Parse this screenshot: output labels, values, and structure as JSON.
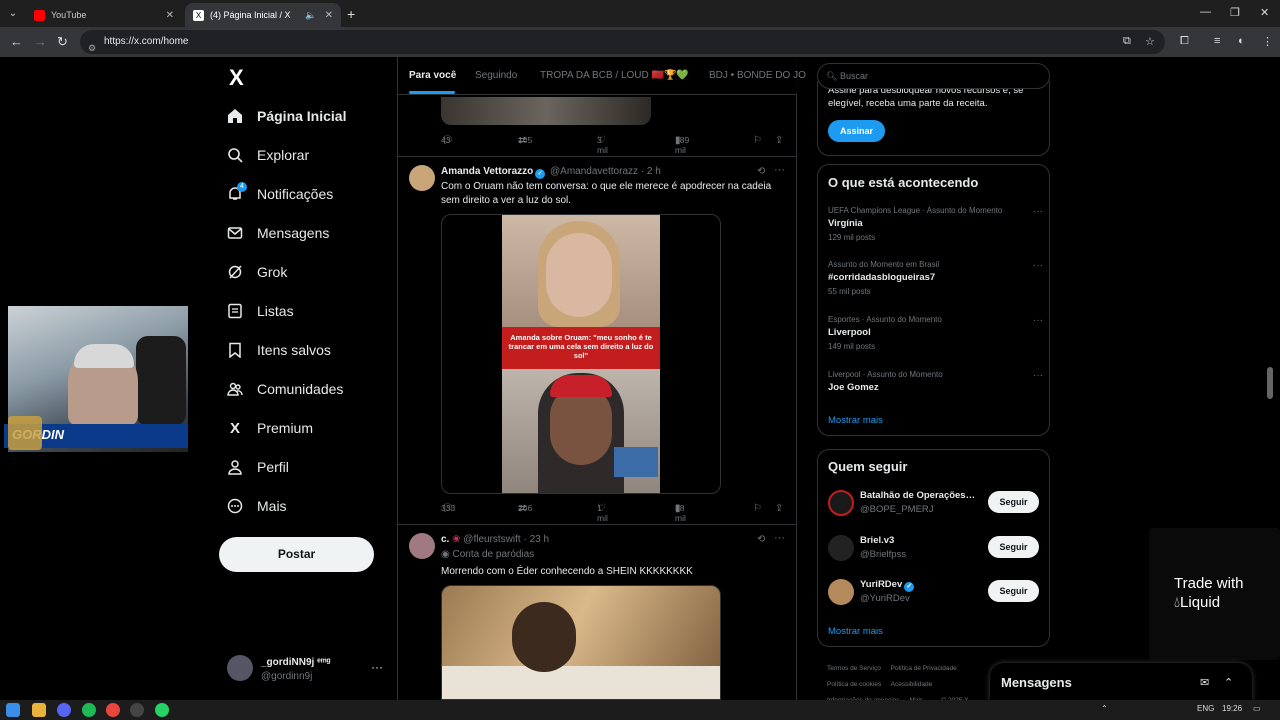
{
  "browser": {
    "tabs": [
      {
        "title": "YouTube",
        "active": false,
        "favicon_color": "#ff0000"
      },
      {
        "title": "(4) Página Inicial / X",
        "active": true,
        "favicon_color": "#ffffff"
      }
    ],
    "url": "https://x.com/home"
  },
  "nav": {
    "logo": "X",
    "items": [
      {
        "label": "Página Inicial",
        "icon": "home-icon"
      },
      {
        "label": "Explorar",
        "icon": "search-icon"
      },
      {
        "label": "Notificações",
        "icon": "bell-icon",
        "badge": "4"
      },
      {
        "label": "Mensagens",
        "icon": "envelope-icon"
      },
      {
        "label": "Grok",
        "icon": "grok-icon"
      },
      {
        "label": "Listas",
        "icon": "list-icon"
      },
      {
        "label": "Itens salvos",
        "icon": "bookmark-icon"
      },
      {
        "label": "Comunidades",
        "icon": "people-icon"
      },
      {
        "label": "Premium",
        "icon": "x-icon"
      },
      {
        "label": "Perfil",
        "icon": "person-icon"
      },
      {
        "label": "Mais",
        "icon": "more-circle-icon"
      }
    ],
    "post_button": "Postar",
    "account": {
      "name": "_gordiNN9j ᵉᵐᵍ",
      "handle": "@gordinn9j"
    }
  },
  "webcam": {
    "overlay_text": "GORDIN"
  },
  "feed": {
    "tabs": [
      "Para você",
      "Seguindo",
      "TROPA DA BCB / LOUD 🇲🇦🏆💚",
      "BDJ • BONDE DO JO"
    ],
    "prev_tweet_actions": {
      "replies": "43",
      "reposts": "105",
      "likes": "3 mil",
      "views": "189 mil"
    },
    "tweets": [
      {
        "name": "Amanda Vettorazzo",
        "handle": "@Amandavettorazz",
        "time": "· 2 h",
        "text": "Com o Oruam não tem conversa: o que ele merece é apodrecer na cadeia sem direito a ver a luz do sol.",
        "media_caption": "Amanda sobre Oruam: \"meu sonho é te trancar em uma cela sem direito a luz do sol\"",
        "actions": {
          "replies": "333",
          "reposts": "206",
          "likes": "1 mil",
          "views": "88 mil"
        }
      },
      {
        "name": "c.",
        "handle": "@fleurstswift",
        "time": "· 23 h",
        "label": "Conta de paródias",
        "text": "Morrendo com o Éder conhecendo a SHEIN KKKKKKKK"
      }
    ]
  },
  "sidebar": {
    "search_placeholder": "Buscar",
    "premium_text": "Assine para desbloquear novos recursos e, se elegível, receba uma parte da receita.",
    "subscribe": "Assinar",
    "trends_title": "O que está acontecendo",
    "trends": [
      {
        "context": "UEFA Champions League · Assunto do Momento",
        "title": "Virgínia",
        "count": "129 mil posts"
      },
      {
        "context": "Assunto do Momento em Brasil",
        "title": "#corridadasblogueiras7",
        "count": "55 mil posts"
      },
      {
        "context": "Esportes · Assunto do Momento",
        "title": "Liverpool",
        "count": "149 mil posts"
      },
      {
        "context": "Liverpool · Assunto do Momento",
        "title": "Joe Gomez",
        "count": ""
      }
    ],
    "show_more": "Mostrar mais",
    "follow_title": "Quem seguir",
    "follow": [
      {
        "name": "Batalhão de Operações…",
        "handle": "@BOPE_PMERJ",
        "button": "Seguir",
        "verified": false
      },
      {
        "name": "Briel.v3",
        "handle": "@Brielfpss",
        "button": "Seguir",
        "verified": false
      },
      {
        "name": "YuriRDev",
        "handle": "@YuriRDev",
        "button": "Seguir",
        "verified": true
      }
    ],
    "follow_more": "Mostrar mais",
    "footer": [
      "Termos de Serviço",
      "Política de Privacidade",
      "Política de cookies",
      "Acessibilidade",
      "Informações de anúncios",
      "Mais ···",
      "© 2025 X"
    ],
    "messages": "Mensagens",
    "ad_text": "Trade with",
    "ad_brand": "Liquid"
  },
  "taskbar": {
    "lang": "ENG",
    "time": "19:26"
  }
}
